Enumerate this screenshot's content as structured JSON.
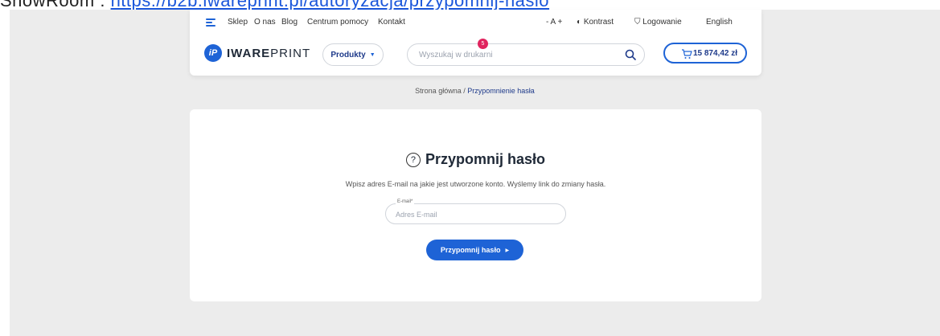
{
  "caption": {
    "prefix": "ShowRoom : ",
    "url": "https://b2b.iwareprint.pl/autoryzacja/przypomnij-haslo"
  },
  "topbar": {
    "nav": [
      "Sklep",
      "O nas",
      "Blog",
      "Centrum pomocy",
      "Kontakt"
    ],
    "font_size_label": "- A +",
    "contrast": "Kontrast",
    "login": "Logowanie",
    "language": "English"
  },
  "header": {
    "logo_badge": "iP",
    "logo_bold": "IWARE",
    "logo_light": "PRINT",
    "products_label": "Produkty",
    "search_placeholder": "Wyszukaj w drukarni",
    "cart_total": "15 874,42 zł",
    "cart_count": "5",
    "accent_color": "#1e63d6"
  },
  "breadcrumb": {
    "home": "Strona główna",
    "separator": "/",
    "current": "Przypomnienie hasła"
  },
  "form": {
    "title": "Przypomnij hasło",
    "description": "Wpisz adres E-mail na jakie jest utworzone konto. Wyślemy link do zmiany hasła.",
    "email_label": "E-mail*",
    "email_placeholder": "Adres E-mail",
    "submit_label": "Przypomnij hasło"
  }
}
